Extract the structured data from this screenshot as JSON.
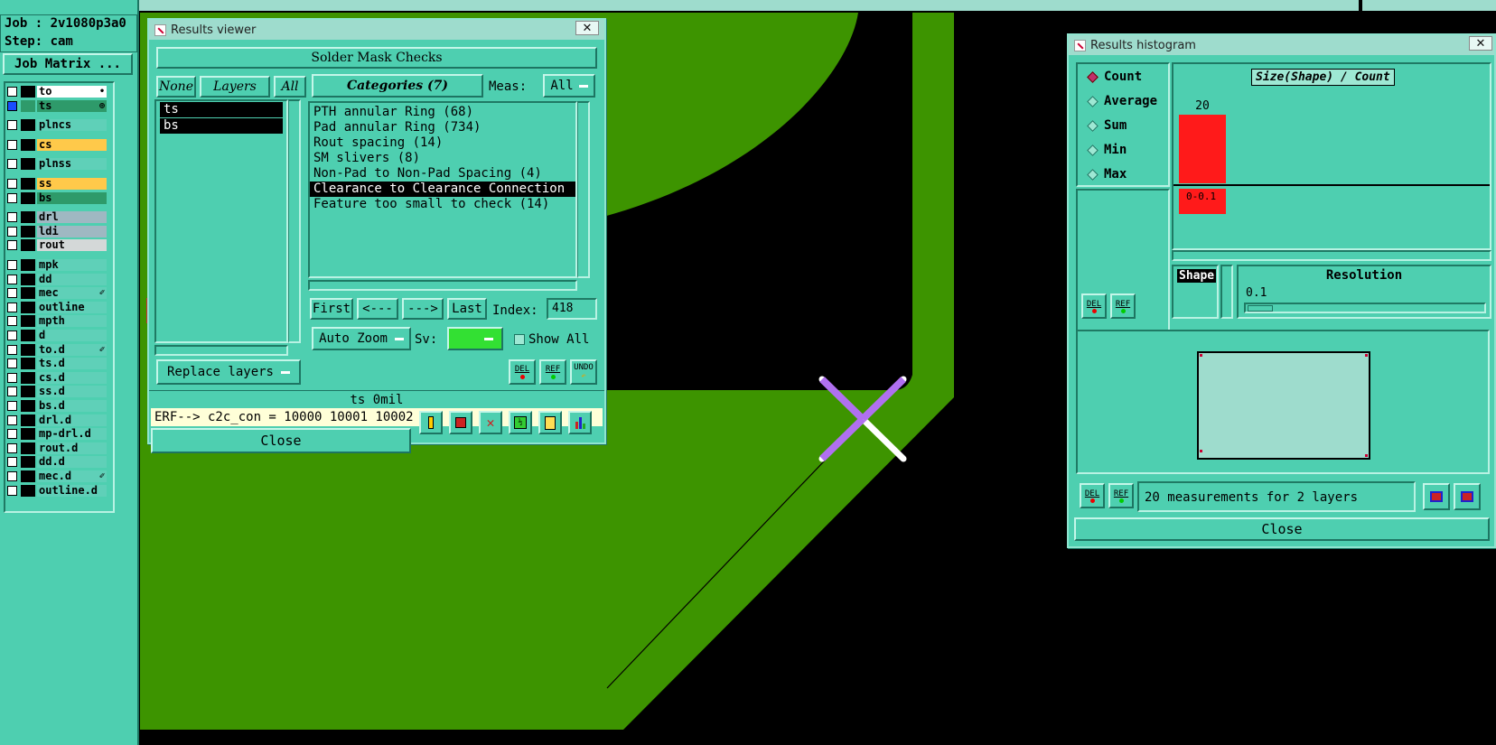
{
  "job_panel": {
    "job_label": "Job : 2v1080p3a0",
    "step_label": "Step: cam",
    "matrix_button": "Job Matrix ..."
  },
  "layers": [
    {
      "name": "to",
      "color": "#ffffff",
      "group": 1,
      "checked": false,
      "selected": false,
      "mark": "•"
    },
    {
      "name": "ts",
      "color": "#2e9a6a",
      "group": 1,
      "checked": true,
      "selected": true,
      "mark": "⊕"
    },
    {
      "name": "plncs",
      "color": "#5fd0b8",
      "group": 2,
      "checked": false,
      "selected": false,
      "mark": ""
    },
    {
      "name": "cs",
      "color": "#ffc94a",
      "group": 3,
      "checked": false,
      "selected": false,
      "mark": ""
    },
    {
      "name": "plnss",
      "color": "#5fd0b8",
      "group": 4,
      "checked": false,
      "selected": false,
      "mark": ""
    },
    {
      "name": "ss",
      "color": "#ffc94a",
      "group": 5,
      "checked": false,
      "selected": false,
      "mark": ""
    },
    {
      "name": "bs",
      "color": "#2e9a6a",
      "group": 5,
      "checked": false,
      "selected": false,
      "mark": ""
    },
    {
      "name": "drl",
      "color": "#9fb8c2",
      "group": 6,
      "checked": false,
      "selected": false,
      "mark": ""
    },
    {
      "name": "ldi",
      "color": "#9fb8c2",
      "group": 6,
      "checked": false,
      "selected": false,
      "mark": ""
    },
    {
      "name": "rout",
      "color": "#d4d8d8",
      "group": 6,
      "checked": false,
      "selected": false,
      "mark": ""
    },
    {
      "name": "mpk",
      "color": "#5fd0b8",
      "group": 7,
      "checked": false,
      "selected": false,
      "mark": ""
    },
    {
      "name": "dd",
      "color": "#5fd0b8",
      "group": 7,
      "checked": false,
      "selected": false,
      "mark": ""
    },
    {
      "name": "mec",
      "color": "#5fd0b8",
      "group": 7,
      "checked": false,
      "selected": false,
      "mark": "✐"
    },
    {
      "name": "outline",
      "color": "#5fd0b8",
      "group": 7,
      "checked": false,
      "selected": false,
      "mark": ""
    },
    {
      "name": "mpth",
      "color": "#5fd0b8",
      "group": 7,
      "checked": false,
      "selected": false,
      "mark": ""
    },
    {
      "name": "d",
      "color": "#5fd0b8",
      "group": 7,
      "checked": false,
      "selected": false,
      "mark": ""
    },
    {
      "name": "to.d",
      "color": "#5fd0b8",
      "group": 7,
      "checked": false,
      "selected": false,
      "mark": "✐"
    },
    {
      "name": "ts.d",
      "color": "#5fd0b8",
      "group": 7,
      "checked": false,
      "selected": false,
      "mark": ""
    },
    {
      "name": "cs.d",
      "color": "#5fd0b8",
      "group": 7,
      "checked": false,
      "selected": false,
      "mark": ""
    },
    {
      "name": "ss.d",
      "color": "#5fd0b8",
      "group": 7,
      "checked": false,
      "selected": false,
      "mark": ""
    },
    {
      "name": "bs.d",
      "color": "#5fd0b8",
      "group": 7,
      "checked": false,
      "selected": false,
      "mark": ""
    },
    {
      "name": "drl.d",
      "color": "#5fd0b8",
      "group": 7,
      "checked": false,
      "selected": false,
      "mark": ""
    },
    {
      "name": "mp-drl.d",
      "color": "#5fd0b8",
      "group": 7,
      "checked": false,
      "selected": false,
      "mark": ""
    },
    {
      "name": "rout.d",
      "color": "#5fd0b8",
      "group": 7,
      "checked": false,
      "selected": false,
      "mark": ""
    },
    {
      "name": "dd.d",
      "color": "#5fd0b8",
      "group": 7,
      "checked": false,
      "selected": false,
      "mark": ""
    },
    {
      "name": "mec.d",
      "color": "#5fd0b8",
      "group": 7,
      "checked": false,
      "selected": false,
      "mark": "✐"
    },
    {
      "name": "outline.d",
      "color": "#5fd0b8",
      "group": 7,
      "checked": false,
      "selected": false,
      "mark": ""
    }
  ],
  "results_viewer": {
    "title": "Results viewer",
    "close_x": "✕",
    "header": "Solder Mask Checks",
    "none_btn": "None",
    "layers_btn": "Layers",
    "all_btn": "All",
    "layer_items": [
      "ts",
      "bs"
    ],
    "categories_btn": "Categories (7)",
    "meas_label": "Meas:",
    "meas_value": "All",
    "categories": [
      "PTH annular Ring (68)",
      "Pad annular Ring (734)",
      "Rout spacing (14)",
      "SM slivers (8)",
      "Non-Pad to Non-Pad Spacing (4)",
      "Clearance to Clearance Connection",
      "Feature too small to check (14)"
    ],
    "selected_category": 5,
    "first_btn": "First",
    "prev_btn": "<---",
    "next_btn": "--->",
    "last_btn": "Last",
    "index_label": "Index:",
    "index_value": "418",
    "autozoom_value": "Auto Zoom",
    "sv_label": "Sv:",
    "show_all_label": "Show All",
    "replace_value": "Replace layers",
    "del_label": "DEL",
    "ref_label": "REF",
    "undo_label": "UNDO",
    "status_line": "ts 0mil",
    "erf_line": "ERF--> c2c_con = 10000 10001 10002",
    "close_btn": "Close"
  },
  "histogram": {
    "title": "Results histogram",
    "close_x": "✕",
    "modes": [
      "Count",
      "Average",
      "Sum",
      "Min",
      "Max"
    ],
    "selected_mode": 0,
    "chart_title": "Size(Shape) / Count",
    "shape_label": "Shape",
    "resolution_label": "Resolution",
    "resolution_value": "0.1",
    "summary": "20 measurements for 2 layers",
    "close_btn": "Close",
    "del_label": "DEL",
    "ref_label": "REF"
  },
  "chart_data": {
    "type": "bar",
    "title": "Size(Shape) / Count",
    "categories": [
      "0-0.1"
    ],
    "values": [
      20
    ],
    "bar_color": "#ff1a1a"
  },
  "colors": {
    "panel": "#4ecfb0",
    "board_green": "#3d9400",
    "marker": "#b070f0",
    "bar_red": "#ff1a1a"
  }
}
